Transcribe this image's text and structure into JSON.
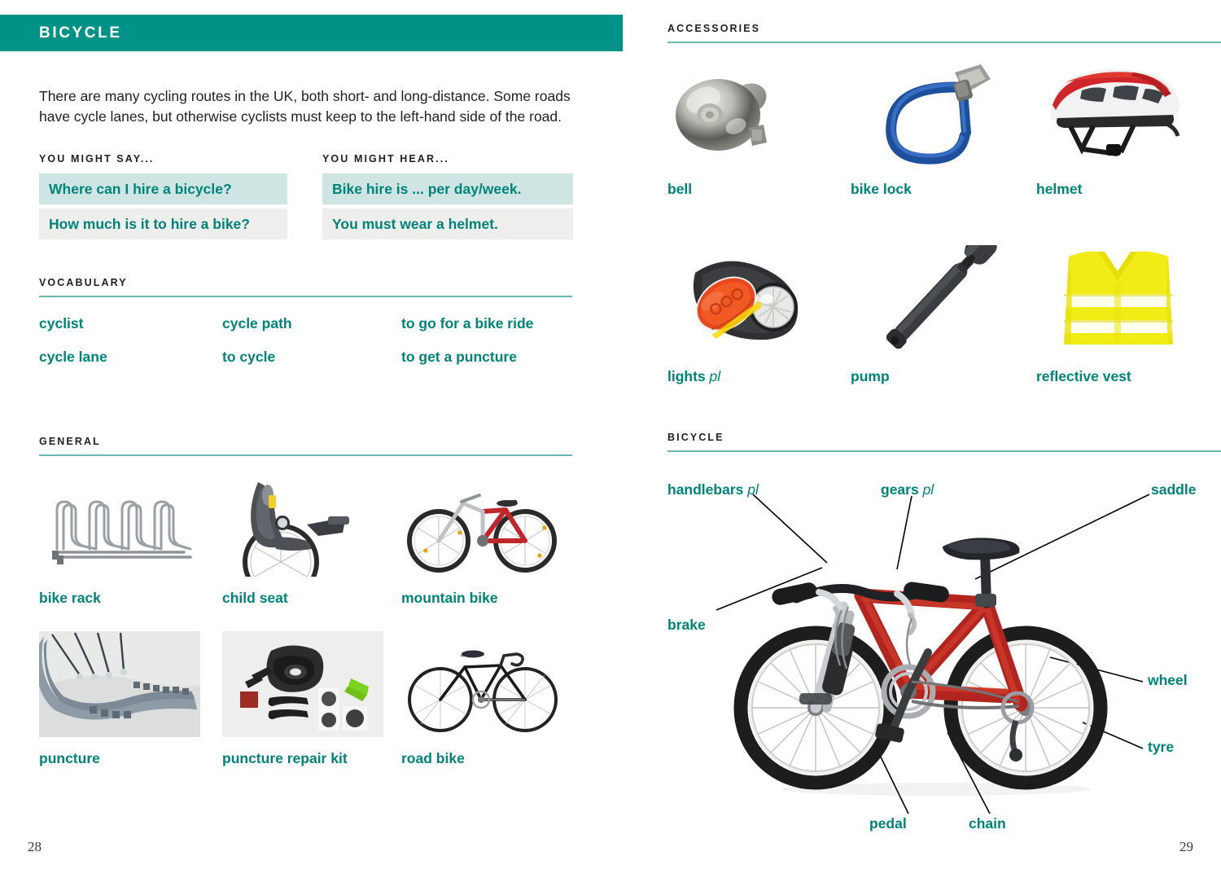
{
  "left_page": {
    "chapter_title": "BICYCLE",
    "intro": "There are many cycling routes in the UK, both short- and long-distance. Some roads have cycle lanes, but otherwise cyclists must keep to the left-hand side of the road.",
    "phrases": {
      "say": {
        "heading": "YOU MIGHT SAY...",
        "rows": [
          "Where can I hire a bicycle?",
          "How much is it to hire a bike?"
        ]
      },
      "hear": {
        "heading": "YOU MIGHT HEAR...",
        "rows": [
          "Bike hire is ... per day/week.",
          "You must wear a helmet."
        ]
      }
    },
    "vocabulary": {
      "heading": "VOCABULARY",
      "items": [
        "cyclist",
        "cycle path",
        "to go for a bike ride",
        "cycle lane",
        "to cycle",
        "to get a puncture"
      ]
    },
    "general": {
      "heading": "GENERAL",
      "items": [
        {
          "label": "bike rack",
          "icon": "bike-rack-photo"
        },
        {
          "label": "child seat",
          "icon": "child-seat-photo"
        },
        {
          "label": "mountain bike",
          "icon": "mountain-bike-photo"
        },
        {
          "label": "puncture",
          "icon": "puncture-photo"
        },
        {
          "label": "puncture repair kit",
          "icon": "puncture-repair-kit-photo"
        },
        {
          "label": "road bike",
          "icon": "road-bike-photo"
        }
      ]
    },
    "folio": "28"
  },
  "right_page": {
    "accessories": {
      "heading": "ACCESSORIES",
      "items": [
        {
          "label": "bell",
          "suffix": "",
          "icon": "bell-photo"
        },
        {
          "label": "bike lock",
          "suffix": "",
          "icon": "bike-lock-photo"
        },
        {
          "label": "helmet",
          "suffix": "",
          "icon": "helmet-photo"
        },
        {
          "label": "lights",
          "suffix": "pl",
          "icon": "lights-photo"
        },
        {
          "label": "pump",
          "suffix": "",
          "icon": "pump-photo"
        },
        {
          "label": "reflective vest",
          "suffix": "",
          "icon": "reflective-vest-photo"
        }
      ]
    },
    "bicycle_diagram": {
      "heading": "BICYCLE",
      "labels": [
        {
          "label": "handlebars",
          "suffix": "pl"
        },
        {
          "label": "gears",
          "suffix": "pl"
        },
        {
          "label": "saddle",
          "suffix": ""
        },
        {
          "label": "brake",
          "suffix": ""
        },
        {
          "label": "wheel",
          "suffix": ""
        },
        {
          "label": "tyre",
          "suffix": ""
        },
        {
          "label": "pedal",
          "suffix": ""
        },
        {
          "label": "chain",
          "suffix": ""
        }
      ]
    },
    "folio": "29"
  },
  "colors": {
    "brand_teal": "#009287",
    "text_teal": "#008378",
    "tint_teal": "#cfe5e3",
    "tint_grey": "#eeeeec",
    "rule": "#6cb7b2",
    "body_text": "#231f20"
  }
}
